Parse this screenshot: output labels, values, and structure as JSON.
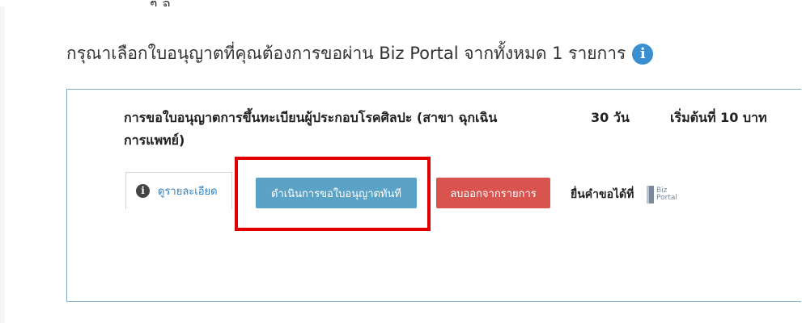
{
  "header": {
    "title": "กรุณาเลือกใบอนุญาตที่คุณต้องการขอผ่าน Biz Portal จากทั้งหมด 1 รายการ",
    "top_cut_text": "ๆ จ"
  },
  "license_item": {
    "title": "การขอใบอนุญาตการขึ้นทะเบียนผู้ประกอบโรคศิลปะ (สาขา ฉุกเฉินการแพทย์)",
    "duration": "30 วัน",
    "fee": "เริ่มต้นที่ 10 บาท",
    "detail_tab_label": "ดูรายละเอียด",
    "proceed_button_label": "ดำเนินการขอใบอนุญาตทันที",
    "remove_button_label": "ลบออกจากรายการ",
    "submit_at_label": "ยื่นคำขอได้ที่",
    "logo_text_line1": "Biz",
    "logo_text_line2": "Portal"
  },
  "icons": {
    "heading_icon": "info-circle-icon",
    "detail_icon": "info-circle-icon"
  },
  "colors": {
    "accent_blue": "#5aa2c6",
    "danger_red": "#d9534f",
    "info_blue": "#3a8fd0",
    "highlight_red": "#e00000"
  }
}
